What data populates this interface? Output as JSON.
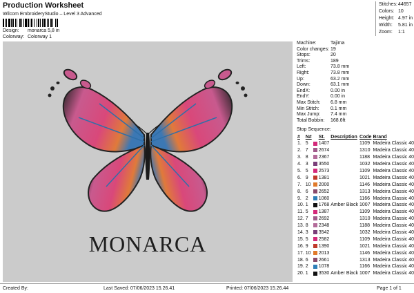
{
  "header": {
    "title": "Production Worksheet",
    "subtitle": "Wilcom EmbroideryStudio – Level 3 Advanced"
  },
  "design": {
    "label": "Design:",
    "value": "monarca 5,8 in"
  },
  "colorway": {
    "label": "Colorway:",
    "value": "Colorway 1"
  },
  "stats": [
    {
      "k": "Stitches:",
      "v": "44657"
    },
    {
      "k": "Colors:",
      "v": "10"
    },
    {
      "k": "Height:",
      "v": "4.97 in"
    },
    {
      "k": "Width:",
      "v": "5.81 in"
    },
    {
      "k": "Zoom:",
      "v": "1:1"
    }
  ],
  "preview": {
    "text": "MONARCA"
  },
  "info": [
    {
      "k": "Machine:",
      "v": "Tajima"
    },
    {
      "k": "Color changes:",
      "v": "19"
    },
    {
      "k": "Stops:",
      "v": "20"
    },
    {
      "k": "Trims:",
      "v": "189"
    },
    {
      "k": "Left:",
      "v": "73.8 mm"
    },
    {
      "k": "Right:",
      "v": "73.8 mm"
    },
    {
      "k": "Up:",
      "v": "63.2 mm"
    },
    {
      "k": "Down:",
      "v": "63.1 mm"
    },
    {
      "k": "EndX:",
      "v": "0.00 in"
    },
    {
      "k": "EndY:",
      "v": "0.00 in"
    },
    {
      "k": "Max Stitch:",
      "v": "6.8 mm"
    },
    {
      "k": "Min Stitch:",
      "v": "0.1 mm"
    },
    {
      "k": "Max Jump:",
      "v": "7.4 mm"
    },
    {
      "k": "Total Bobbin:",
      "v": "168.6ft"
    }
  ],
  "sequence": {
    "label": "Stop Sequence:",
    "headers": [
      "#",
      "N#",
      "St.",
      "Description",
      "Code",
      "Brand"
    ],
    "rows": [
      {
        "n": "1.",
        "nn": "5",
        "color": "#d4287a",
        "st": "1407",
        "desc": "",
        "code": "1109",
        "brand": "Madeira Classic 40"
      },
      {
        "n": "2.",
        "nn": "7",
        "color": "#a05a8a",
        "st": "2674",
        "desc": "",
        "code": "1310",
        "brand": "Madeira Classic 40"
      },
      {
        "n": "3.",
        "nn": "8",
        "color": "#b36b9a",
        "st": "2367",
        "desc": "",
        "code": "1188",
        "brand": "Madeira Classic 40"
      },
      {
        "n": "4.",
        "nn": "3",
        "color": "#7a3f7a",
        "st": "3550",
        "desc": "",
        "code": "1032",
        "brand": "Madeira Classic 40"
      },
      {
        "n": "5.",
        "nn": "5",
        "color": "#d4287a",
        "st": "2573",
        "desc": "",
        "code": "1109",
        "brand": "Madeira Classic 40"
      },
      {
        "n": "6.",
        "nn": "9",
        "color": "#c0392b",
        "st": "1381",
        "desc": "",
        "code": "1021",
        "brand": "Madeira Classic 40"
      },
      {
        "n": "7.",
        "nn": "10",
        "color": "#e07a2a",
        "st": "2000",
        "desc": "",
        "code": "1146",
        "brand": "Madeira Classic 40"
      },
      {
        "n": "8.",
        "nn": "6",
        "color": "#8a4a6a",
        "st": "2652",
        "desc": "",
        "code": "1313",
        "brand": "Madeira Classic 40"
      },
      {
        "n": "9.",
        "nn": "2",
        "color": "#2f7fb8",
        "st": "1060",
        "desc": "",
        "code": "1166",
        "brand": "Madeira Classic 40"
      },
      {
        "n": "10.",
        "nn": "1",
        "color": "#111111",
        "st": "1768",
        "desc": "Amber Black",
        "code": "1007",
        "brand": "Madeira Classic 40"
      },
      {
        "n": "11.",
        "nn": "5",
        "color": "#d4287a",
        "st": "1387",
        "desc": "",
        "code": "1109",
        "brand": "Madeira Classic 40"
      },
      {
        "n": "12.",
        "nn": "7",
        "color": "#a05a8a",
        "st": "2692",
        "desc": "",
        "code": "1310",
        "brand": "Madeira Classic 40"
      },
      {
        "n": "13.",
        "nn": "8",
        "color": "#b36b9a",
        "st": "2348",
        "desc": "",
        "code": "1188",
        "brand": "Madeira Classic 40"
      },
      {
        "n": "14.",
        "nn": "3",
        "color": "#7a3f7a",
        "st": "3542",
        "desc": "",
        "code": "1032",
        "brand": "Madeira Classic 40"
      },
      {
        "n": "15.",
        "nn": "5",
        "color": "#d4287a",
        "st": "2582",
        "desc": "",
        "code": "1109",
        "brand": "Madeira Classic 40"
      },
      {
        "n": "16.",
        "nn": "9",
        "color": "#c0392b",
        "st": "1390",
        "desc": "",
        "code": "1021",
        "brand": "Madeira Classic 40"
      },
      {
        "n": "17.",
        "nn": "10",
        "color": "#e07a2a",
        "st": "2013",
        "desc": "",
        "code": "1146",
        "brand": "Madeira Classic 40"
      },
      {
        "n": "18.",
        "nn": "6",
        "color": "#8a4a6a",
        "st": "2661",
        "desc": "",
        "code": "1313",
        "brand": "Madeira Classic 40"
      },
      {
        "n": "19.",
        "nn": "2",
        "color": "#2f7fb8",
        "st": "1078",
        "desc": "",
        "code": "1166",
        "brand": "Madeira Classic 40"
      },
      {
        "n": "20.",
        "nn": "1",
        "color": "#111111",
        "st": "3530",
        "desc": "Amber Black",
        "code": "1007",
        "brand": "Madeira Classic 40"
      }
    ]
  },
  "footer": {
    "created": "Created By:",
    "saved": "Last Saved: 07/06/2023 15.26.41",
    "printed": "Printed: 07/06/2023 15.26.44",
    "page": "Page 1 of 1"
  }
}
